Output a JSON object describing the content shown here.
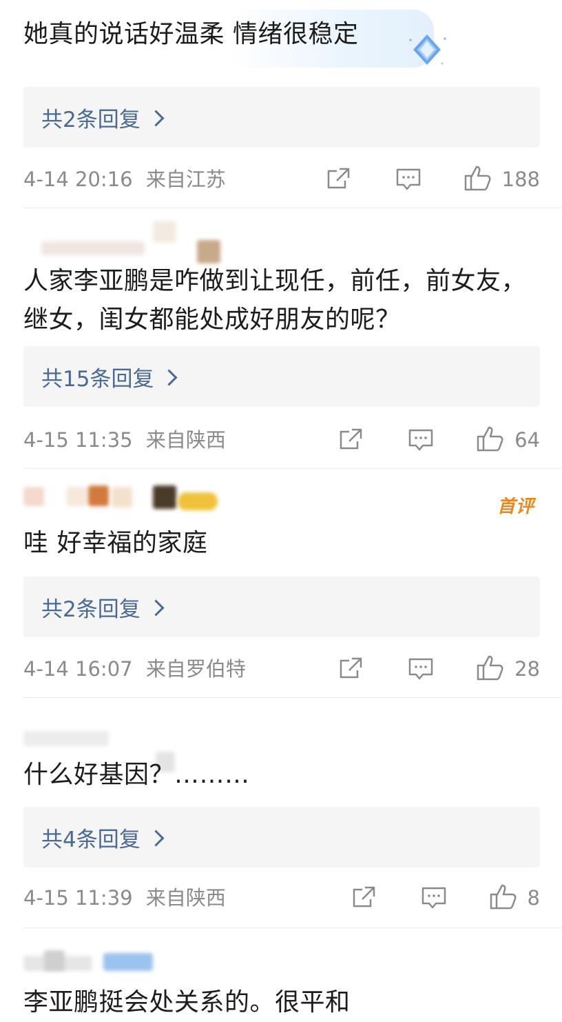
{
  "comments": [
    {
      "text": "她真的说话好温柔 情绪很稳定",
      "reply_label": "共2条回复",
      "time": "4-14 20:16",
      "location": "来自江苏",
      "likes": "188"
    },
    {
      "text": "人家李亚鹏是咋做到让现任，前任，前女友，继女，闺女都能处成好朋友的呢？",
      "reply_label": "共15条回复",
      "time": "4-15 11:35",
      "location": "来自陕西",
      "likes": "64"
    },
    {
      "text": "哇 好幸福的家庭",
      "badge": "首评",
      "reply_label": "共2条回复",
      "time": "4-14 16:07",
      "location": "来自罗伯特",
      "likes": "28"
    },
    {
      "text": "什么好基因？………",
      "reply_label": "共4条回复",
      "time": "4-15 11:39",
      "location": "来自陕西",
      "likes": "8"
    },
    {
      "text": "李亚鹏挺会处关系的。很平和"
    }
  ],
  "icons": {
    "share": "share-icon",
    "comment": "comment-icon",
    "like": "thumbs-up-icon",
    "emblem": "diamond-emblem-icon"
  },
  "colors": {
    "link": "#4a6a93",
    "meta": "#8a8a8a",
    "badge": "#e8891f",
    "reply_bg": "#f5f5f5"
  }
}
